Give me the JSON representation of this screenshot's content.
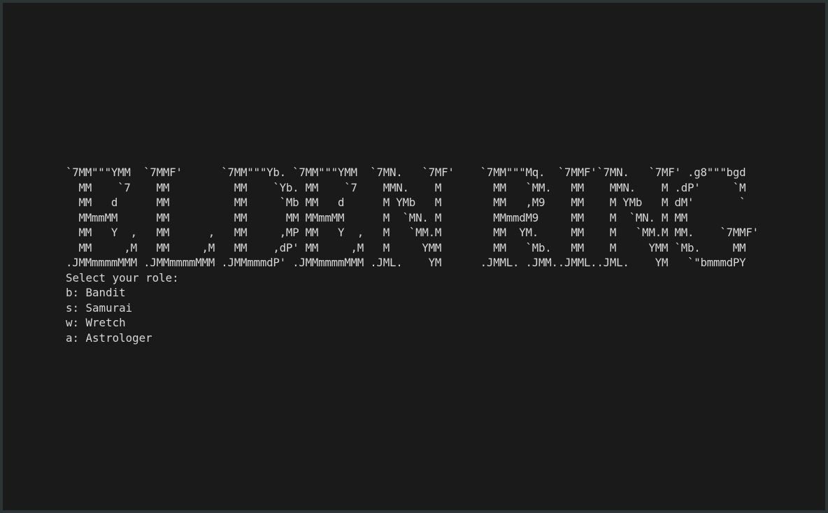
{
  "banner": {
    "lines": [
      "`7MM\"\"\"YMM  `7MMF'      `7MM\"\"\"Yb. `7MM\"\"\"YMM  `7MN.   `7MF'    `7MM\"\"\"Mq.  `7MMF'`7MN.   `7MF' .g8\"\"\"bgd",
      "  MM    `7    MM          MM    `Yb. MM    `7    MMN.    M        MM   `MM.   MM    MMN.    M .dP'     `M",
      "  MM   d      MM          MM     `Mb MM   d      M YMb   M        MM   ,M9    MM    M YMb   M dM'       `",
      "  MMmmMM      MM          MM      MM MMmmMM      M  `MN. M        MMmmdM9     MM    M  `MN. M MM",
      "  MM   Y  ,   MM      ,   MM     ,MP MM   Y  ,   M   `MM.M        MM  YM.     MM    M   `MM.M MM.    `7MMF'",
      "  MM     ,M   MM     ,M   MM    ,dP' MM     ,M   M     YMM        MM   `Mb.   MM    M     YMM `Mb.     MM",
      ".JMMmmmmMMM .JMMmmmmMMM .JMMmmmdP' .JMMmmmmMMM .JML.    YM      .JMML. .JMM..JMML..JML.    YM   `\"bmmmdPY"
    ]
  },
  "prompt": "Select your role:",
  "roles": [
    "b: Bandit",
    "s: Samurai",
    "w: Wretch",
    "a: Astrologer"
  ],
  "colors": {
    "background": "#1a1a1a",
    "frame": "#2c3436",
    "text": "#d8d8d8"
  }
}
